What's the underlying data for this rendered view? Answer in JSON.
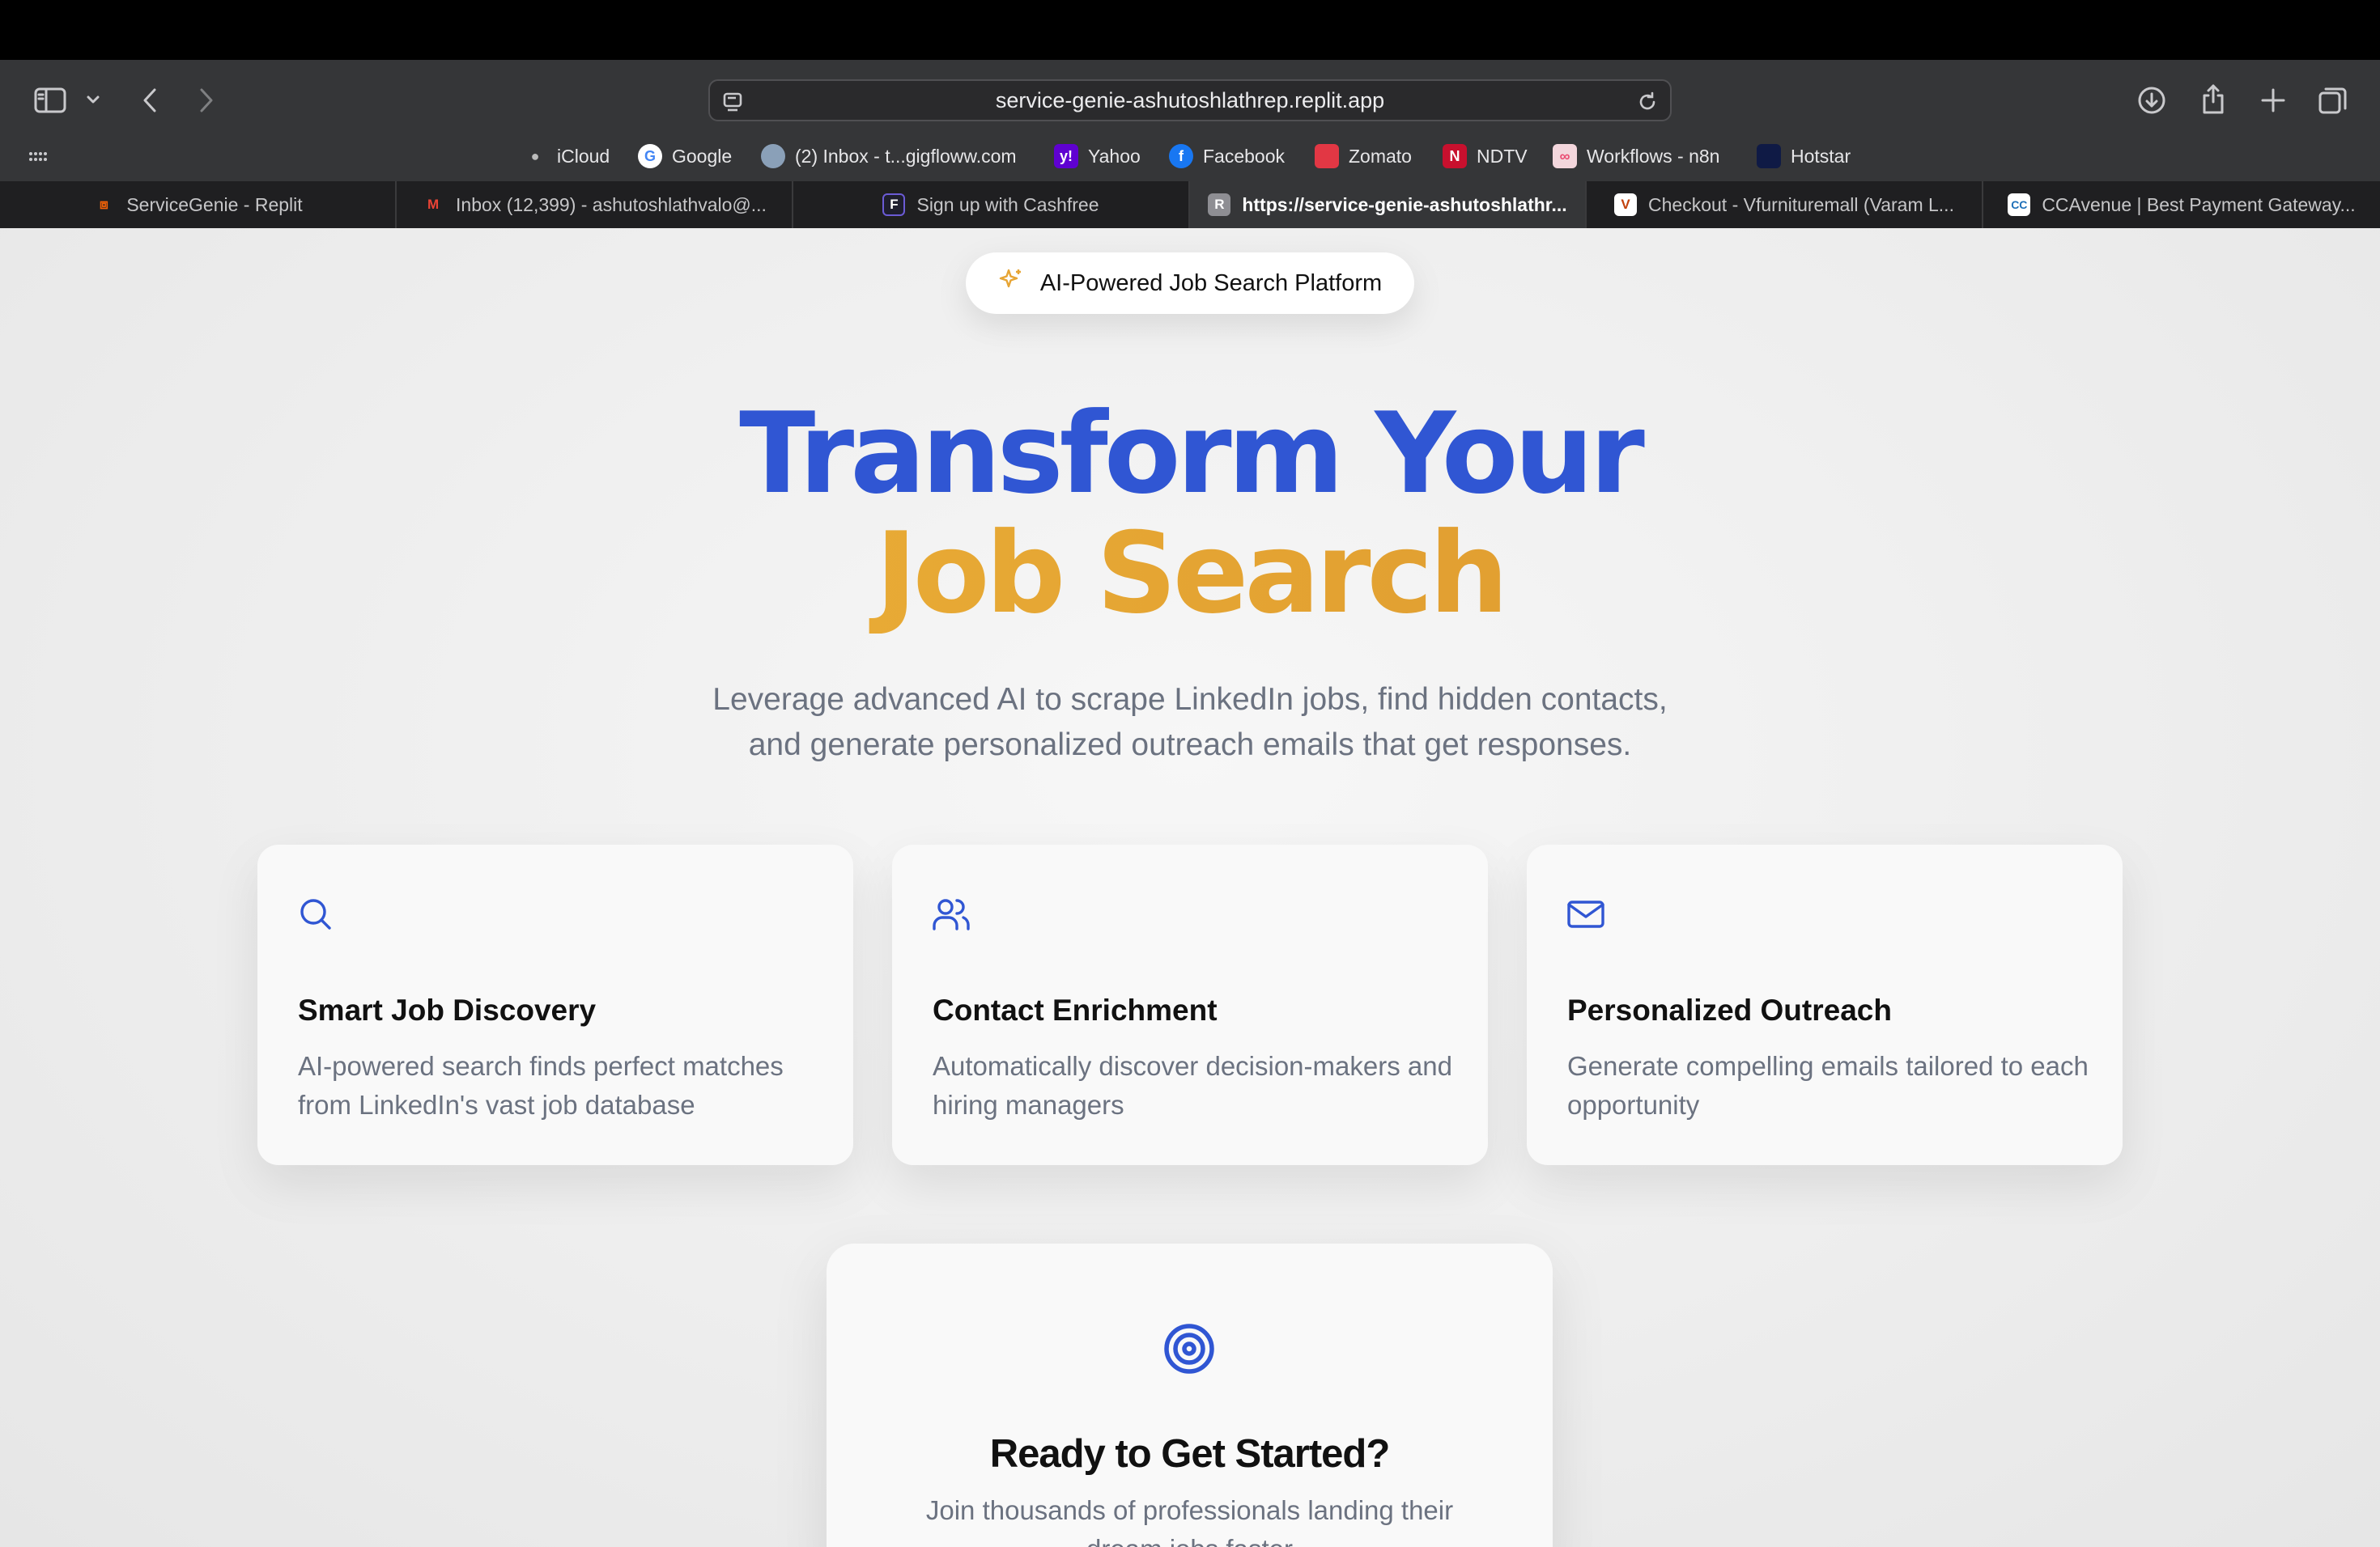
{
  "browser": {
    "url": "service-genie-ashutoshlathrep.replit.app",
    "favorites": [
      {
        "label": "iCloud",
        "icon": "apple-icon"
      },
      {
        "label": "Google",
        "icon": "google-icon"
      },
      {
        "label": "(2) Inbox - t...gigfloww.com",
        "icon": "inbox-icon"
      },
      {
        "label": "Yahoo",
        "icon": "yahoo-icon"
      },
      {
        "label": "Facebook",
        "icon": "facebook-icon"
      },
      {
        "label": "Zomato",
        "icon": "zomato-icon"
      },
      {
        "label": "NDTV",
        "icon": "ndtv-icon"
      },
      {
        "label": "Workflows - n8n",
        "icon": "n8n-icon"
      },
      {
        "label": "Hotstar",
        "icon": "hotstar-icon"
      }
    ],
    "tabs": [
      {
        "label": "ServiceGenie - Replit",
        "icon": "replit-icon",
        "active": false
      },
      {
        "label": "Inbox (12,399) - ashutoshlathvalo@...",
        "icon": "gmail-icon",
        "active": false
      },
      {
        "label": "Sign up with Cashfree",
        "icon": "cashfree-icon",
        "active": false
      },
      {
        "label": "https://service-genie-ashutoshlathr...",
        "icon": "r-icon",
        "active": true
      },
      {
        "label": "Checkout - Vfurnituremall (Varam L...",
        "icon": "vfurniture-icon",
        "active": false
      },
      {
        "label": "CCAvenue | Best Payment Gateway...",
        "icon": "ccavenue-icon",
        "active": false
      }
    ]
  },
  "hero": {
    "badge": "AI-Powered Job Search Platform",
    "title_line1": "Transform Your",
    "title_line2": "Job Search",
    "subtitle_line1": "Leverage advanced AI to scrape LinkedIn jobs, find hidden contacts,",
    "subtitle_line2": "and generate personalized outreach emails that get responses."
  },
  "features": [
    {
      "title": "Smart Job Discovery",
      "desc": "AI-powered search finds perfect matches from LinkedIn's vast job database",
      "icon": "search-icon"
    },
    {
      "title": "Contact Enrichment",
      "desc": "Automatically discover decision-makers and hiring managers",
      "icon": "users-icon"
    },
    {
      "title": "Personalized Outreach",
      "desc": "Generate compelling emails tailored to each opportunity",
      "icon": "mail-icon"
    }
  ],
  "cta": {
    "title": "Ready to Get Started?",
    "text": "Join thousands of professionals landing their dream jobs faster",
    "icon": "target-icon"
  },
  "colors": {
    "primary": "#3056d3",
    "accent": "#e7a534",
    "muted_text": "#6b7280"
  }
}
